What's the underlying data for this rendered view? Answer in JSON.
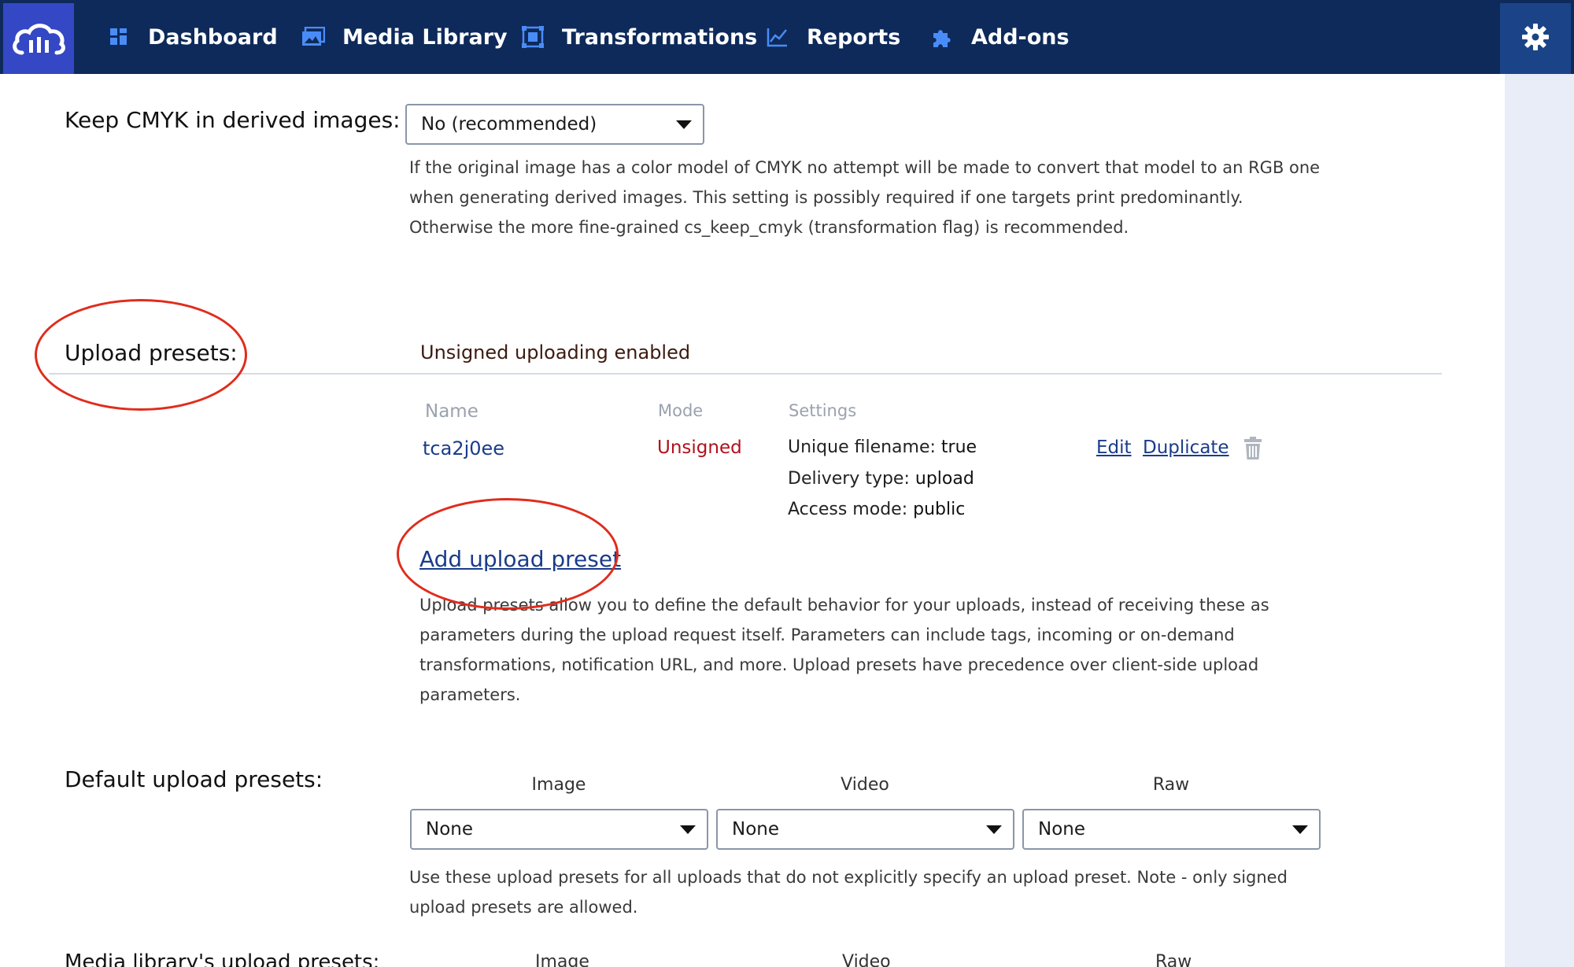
{
  "nav": {
    "items": [
      {
        "label": "Dashboard",
        "icon": "dashboard-icon"
      },
      {
        "label": "Media Library",
        "icon": "media-library-icon"
      },
      {
        "label": "Transformations",
        "icon": "transformations-icon"
      },
      {
        "label": "Reports",
        "icon": "reports-icon"
      },
      {
        "label": "Add-ons",
        "icon": "puzzle-icon"
      }
    ],
    "settings_icon": "gear-icon",
    "logo_icon": "cloud-logo-icon"
  },
  "cmyk": {
    "label": "Keep CMYK in derived images:",
    "selected": "No (recommended)",
    "help": [
      "If the original image has a color model of CMYK no attempt will be made to convert that model to an RGB one",
      "when generating derived images. This setting is possibly required if one targets print predominantly.",
      "Otherwise the more fine-grained cs_keep_cmyk (transformation flag) is recommended."
    ]
  },
  "upload_presets": {
    "label": "Upload presets:",
    "status": "Unsigned uploading enabled",
    "headers": {
      "name": "Name",
      "mode": "Mode",
      "settings": "Settings"
    },
    "preset": {
      "name": "tca2j0ee",
      "mode": "Unsigned",
      "settings": [
        {
          "key": "Unique filename:",
          "value": "true"
        },
        {
          "key": "Delivery type:",
          "value": "upload"
        },
        {
          "key": "Access mode:",
          "value": "public"
        }
      ],
      "edit": "Edit",
      "duplicate": "Duplicate"
    },
    "add_link": "Add upload preset",
    "help": [
      "Upload presets allow you to define the default behavior for your uploads, instead of receiving these as",
      "parameters during the upload request itself. Parameters can include tags, incoming or on-demand",
      "transformations, notification URL, and more. Upload presets have precedence over client-side upload",
      "parameters."
    ]
  },
  "default_presets": {
    "label": "Default upload presets:",
    "columns": [
      {
        "header": "Image",
        "selected": "None"
      },
      {
        "header": "Video",
        "selected": "None"
      },
      {
        "header": "Raw",
        "selected": "None"
      }
    ],
    "help": [
      "Use these upload presets for all uploads that do not explicitly specify an upload preset. Note - only signed",
      "upload presets are allowed."
    ]
  },
  "media_library_presets": {
    "label": "Media library's upload presets:",
    "columns": [
      "Image",
      "Video",
      "Raw"
    ]
  },
  "colors": {
    "nav_bg": "#0e2a5a",
    "logo_bg": "#3448c5",
    "link": "#1a3c8a",
    "mode_unsigned": "#b3101a",
    "annotation": "#e02c1c"
  }
}
